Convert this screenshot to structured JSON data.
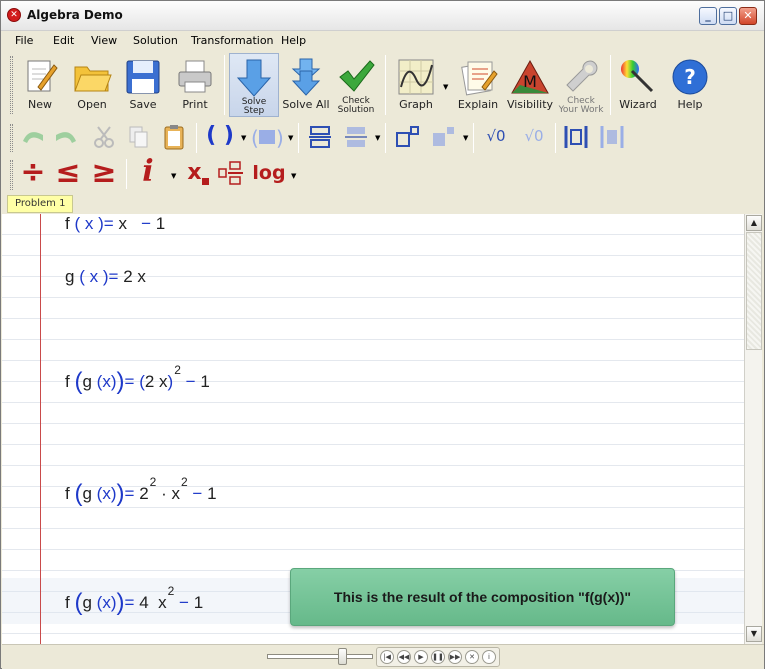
{
  "window": {
    "title": "Algebra Demo",
    "app_icon": "x-circle-icon"
  },
  "menu": [
    "File",
    "Edit",
    "View",
    "Solution",
    "Transformation",
    "Help"
  ],
  "toolbar": {
    "new": "New",
    "open": "Open",
    "save": "Save",
    "print": "Print",
    "solve_step_1": "Solve",
    "solve_step_2": "Step",
    "solve_all": "Solve All",
    "check_solution_1": "Check",
    "check_solution_2": "Solution",
    "graph": "Graph",
    "explain": "Explain",
    "visibility": "Visibility",
    "check_work_1": "Check",
    "check_work_2": "Your Work",
    "wizard": "Wizard",
    "help": "Help",
    "visibility_glyph": "M",
    "paren_glyph": "( )",
    "imag_glyph": "i",
    "sub_glyph": "x",
    "log_glyph": "log",
    "le_glyph": "≤",
    "ge_glyph": "≥",
    "div_glyph": "÷",
    "help_glyph": "?",
    "sqrt_glyph": "√0"
  },
  "tabs": {
    "problem1": "Problem 1"
  },
  "equations": {
    "e1": {
      "lhs_fn": "f",
      "lp": "(",
      "var": "x",
      "rp": ")",
      "eq": "=",
      "body": "x",
      "op": "−",
      "tail": "1"
    },
    "e2": {
      "lhs_fn": "g",
      "lp": "(",
      "var": "x",
      "rp": ")",
      "eq": "=",
      "body": "2 x"
    },
    "e3": {
      "outer": "f",
      "inner": "g",
      "var": "x",
      "eq": "=",
      "base": "2 x",
      "exp": "2",
      "op": "−",
      "tail": "1"
    },
    "e4": {
      "outer": "f",
      "inner": "g",
      "var": "x",
      "eq": "=",
      "c": "2",
      "cexp": "2",
      "dot": "·",
      "x": "x",
      "xexp": "2",
      "op": "−",
      "tail": "1"
    },
    "e5": {
      "outer": "f",
      "inner": "g",
      "var": "x",
      "eq": "=",
      "c": "4",
      "x": "x",
      "xexp": "2",
      "op": "−",
      "tail": "1"
    }
  },
  "callout": "This is the result of the composition \"f(g(x))\"",
  "colors": {
    "accent_blue": "#1e39c9",
    "margin_red": "#c94a4a",
    "callout_green": "#76c497",
    "tab_yellow": "#ffffa6"
  }
}
